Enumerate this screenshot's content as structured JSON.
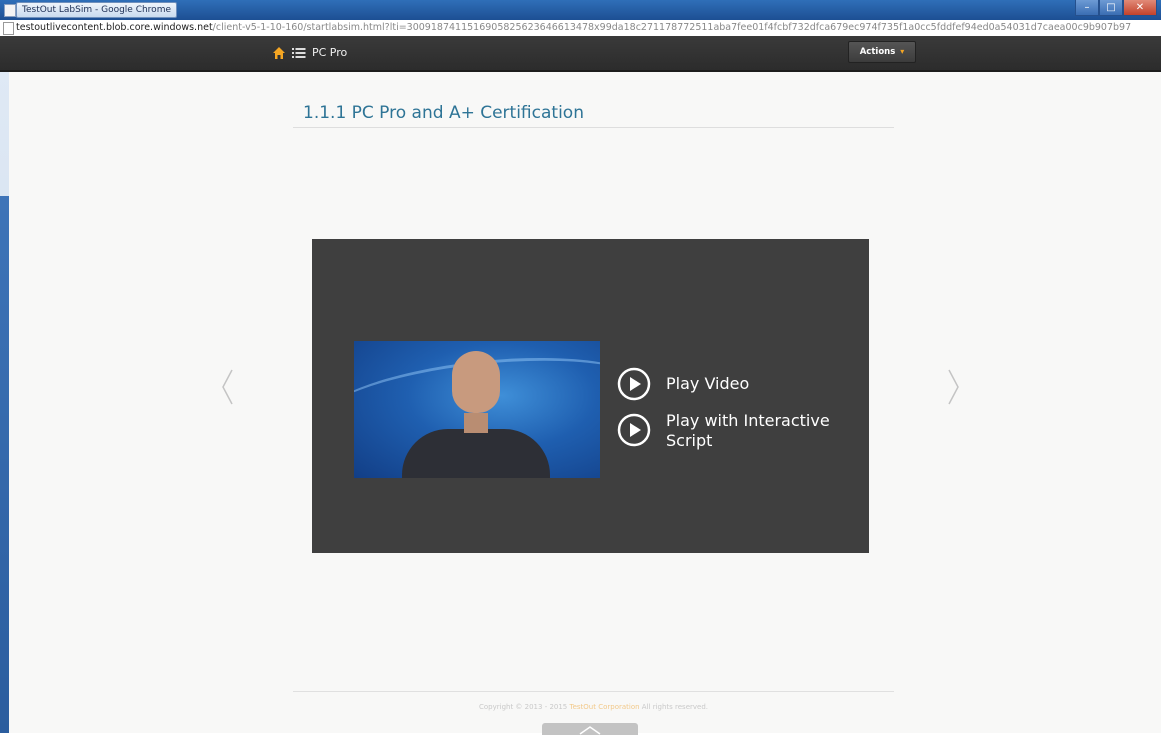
{
  "window": {
    "title": "TestOut LabSim - Google Chrome",
    "controls": [
      "minimize",
      "maximize",
      "close"
    ]
  },
  "address": {
    "host": "testoutlivecontent.blob.core.windows.net",
    "path": "/client-v5-1-10-160/startlabsim.html?lti=3009187411516905825623646613478x99da18c271178772511aba7fee01f4fcbf732dfca679ec974f735f1a0cc5fddfef94ed0a54031d7caea00c9b907b97"
  },
  "appbar": {
    "home_icon": "home-icon",
    "menu_icon": "list-menu-icon",
    "course_title": "PC Pro",
    "actions_label": "Actions",
    "actions_caret": "▾"
  },
  "lesson": {
    "title": "1.1.1 PC Pro and A+ Certification"
  },
  "video": {
    "play_video_label": "Play Video",
    "play_script_label": "Play with Interactive Script"
  },
  "footer": {
    "copyright_prefix": "Copyright © 2013 - 2015",
    "company": "TestOut Corporation",
    "copyright_suffix": "All rights reserved."
  },
  "colors": {
    "accent": "#2e7496",
    "appbar": "#333333",
    "home_icon": "#f5a623",
    "panel": "#3f3f3f"
  }
}
